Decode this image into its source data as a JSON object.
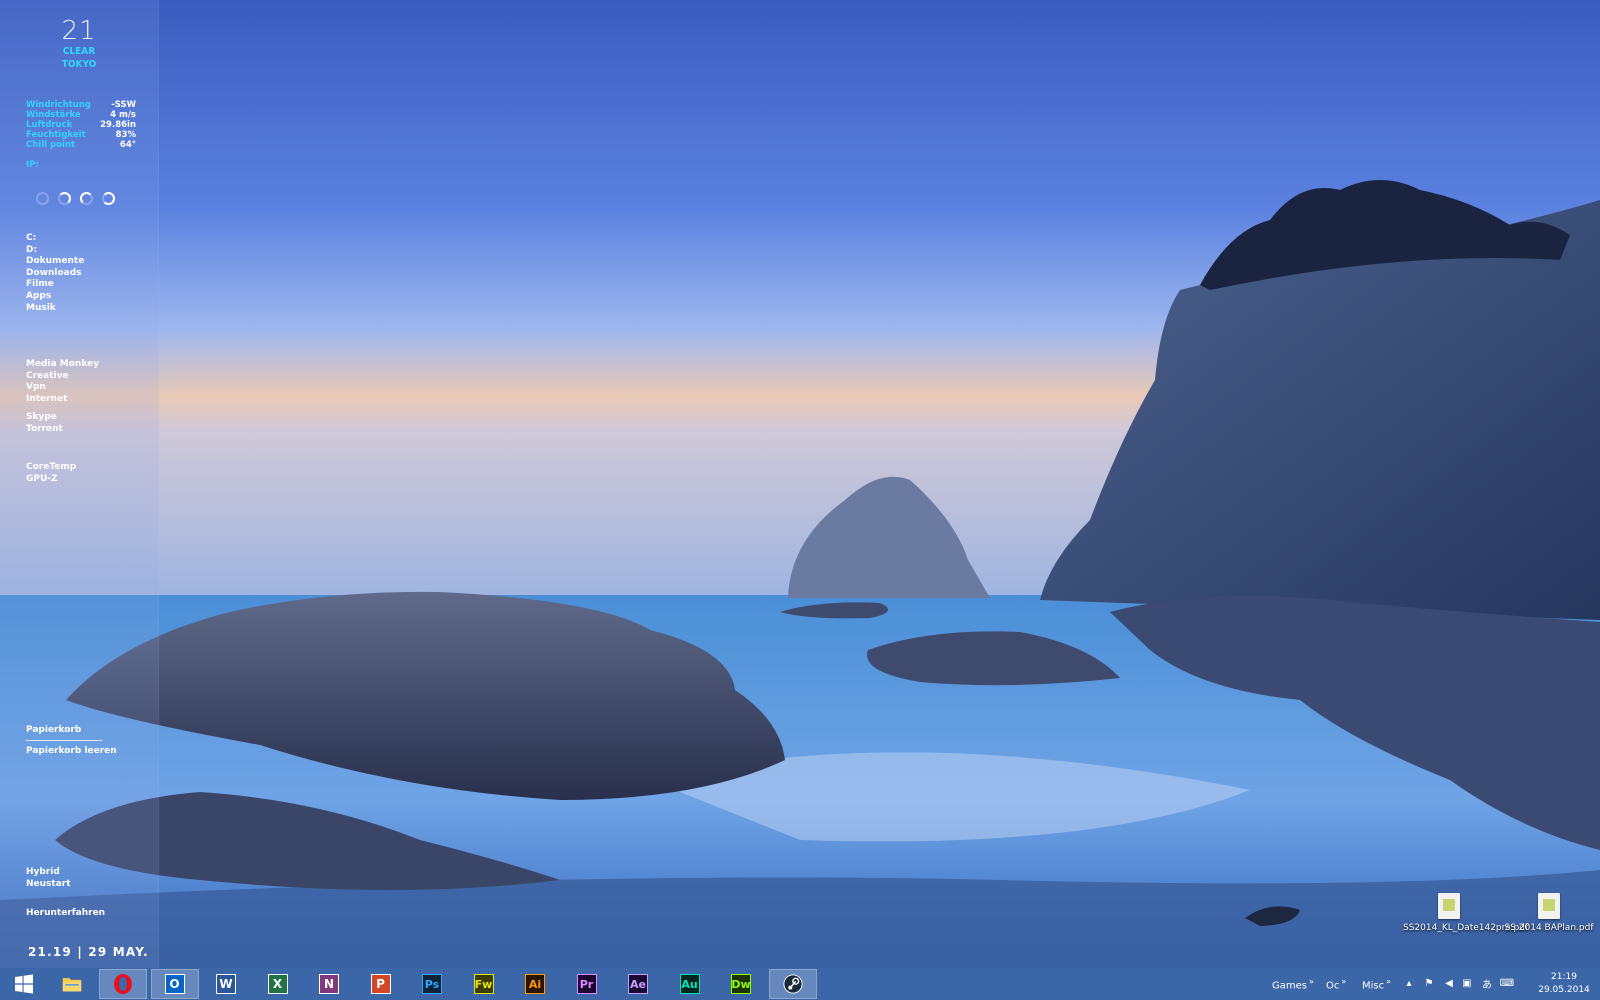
{
  "sidebar": {
    "clock_hour": "21",
    "clock_city_line1": "CLEAR",
    "clock_city_line2": "TOKYO",
    "weather": [
      {
        "label": "Windrichtung",
        "value": "-SSW"
      },
      {
        "label": "Windstärke",
        "value": "4 m/s"
      },
      {
        "label": "Luftdruck",
        "value": "29.86in"
      },
      {
        "label": "Feuchtigkeit",
        "value": "83%"
      },
      {
        "label": "Chill point",
        "value": "64°"
      }
    ],
    "ip_label": "IP:",
    "drives": [
      "C:",
      "D:",
      "Dokumente",
      "Downloads",
      "Filme",
      "Apps",
      "Musik"
    ],
    "apps_group1": [
      "Media Monkey",
      "Creative",
      "Vpn",
      "Internet"
    ],
    "apps_group2": [
      "Skype",
      "Torrent"
    ],
    "tools": [
      "CoreTemp",
      "GPU-Z"
    ],
    "recycle": "Papierkorb",
    "recycle_empty": "Papierkorb leeren",
    "power": [
      "Hybrid",
      "Neustart"
    ],
    "shutdown": "Herunterfahren",
    "date_strip": "21.19 | 29 MAY."
  },
  "desktop_icons": [
    {
      "label": "SS2014_KL_Date142pre.pdf"
    },
    {
      "label": "SS 2014 BAPlan.pdf"
    }
  ],
  "taskbar": {
    "apps": [
      {
        "icon": "windows-start-icon",
        "text": "",
        "bg": "",
        "fg": "#ffffff"
      },
      {
        "icon": "file-explorer-icon",
        "text": "",
        "bg": "#f2c94c",
        "fg": "#7a5a00"
      },
      {
        "icon": "opera-icon",
        "text": "O",
        "bg": "",
        "fg": "#e8101b"
      },
      {
        "icon": "outlook-icon",
        "text": "O",
        "bg": "#0a64c4",
        "fg": "#ffffff"
      },
      {
        "icon": "word-icon",
        "text": "W",
        "bg": "#2b579a",
        "fg": "#ffffff"
      },
      {
        "icon": "excel-icon",
        "text": "X",
        "bg": "#217346",
        "fg": "#ffffff"
      },
      {
        "icon": "onenote-icon",
        "text": "N",
        "bg": "#80397b",
        "fg": "#ffffff"
      },
      {
        "icon": "powerpoint-icon",
        "text": "P",
        "bg": "#d24726",
        "fg": "#ffffff"
      },
      {
        "icon": "photoshop-icon",
        "text": "Ps",
        "bg": "#0d2336",
        "fg": "#31a8ff"
      },
      {
        "icon": "fireworks-icon",
        "text": "Fw",
        "bg": "#3b3d00",
        "fg": "#e6e612"
      },
      {
        "icon": "illustrator-icon",
        "text": "Ai",
        "bg": "#2c1404",
        "fg": "#ff9a00"
      },
      {
        "icon": "premiere-icon",
        "text": "Pr",
        "bg": "#1f0631",
        "fg": "#d98cff"
      },
      {
        "icon": "after-effects-icon",
        "text": "Ae",
        "bg": "#1a0a33",
        "fg": "#c6a0ff"
      },
      {
        "icon": "audition-icon",
        "text": "Au",
        "bg": "#00271f",
        "fg": "#00e4bb"
      },
      {
        "icon": "dreamweaver-icon",
        "text": "Dw",
        "bg": "#1e3300",
        "fg": "#8fff00"
      },
      {
        "icon": "steam-icon",
        "text": "",
        "bg": "",
        "fg": "#ffffff"
      }
    ],
    "toolbars": [
      "Games",
      "Oc",
      "Misc"
    ],
    "tray_time": "21:19",
    "tray_date": "29.05.2014"
  }
}
